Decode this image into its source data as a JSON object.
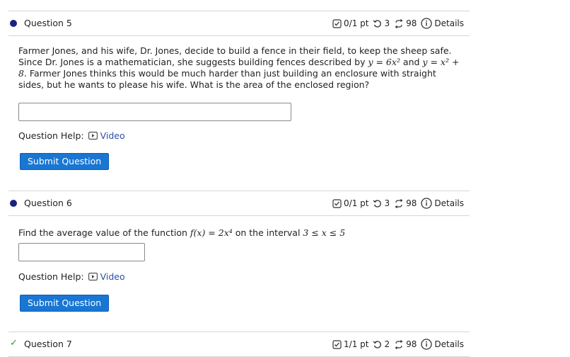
{
  "questions": [
    {
      "title": "Question 5",
      "status": "unanswered",
      "score": "0/1 pt",
      "retries": "3",
      "attempts": "98",
      "details": "Details",
      "text_parts": [
        "Farmer Jones, and his wife, Dr. Jones, decide to build a fence in their field, to keep the sheep safe. Since Dr. Jones is a mathematician, she suggests building fences described by ",
        "y = 6x²",
        " and ",
        "y = x² + 8",
        ". Farmer Jones thinks this would be much harder than just building an enclosure with straight sides, but he wants to please his wife. What is the area of the enclosed region?"
      ],
      "help_label": "Question Help:",
      "video_label": "Video",
      "submit_label": "Submit Question"
    },
    {
      "title": "Question 6",
      "status": "unanswered",
      "score": "0/1 pt",
      "retries": "3",
      "attempts": "98",
      "details": "Details",
      "text_parts": [
        "Find the average value of the function ",
        "f(x) = 2x⁴",
        " on the interval ",
        "3 ≤ x ≤ 5"
      ],
      "help_label": "Question Help:",
      "video_label": "Video",
      "submit_label": "Submit Question"
    },
    {
      "title": "Question 7",
      "status": "correct",
      "score": "1/1 pt",
      "retries": "2",
      "attempts": "98",
      "details": "Details"
    }
  ],
  "colors": {
    "accent": "#1976d2",
    "bullet": "#1a237e",
    "link": "#2d4fa3",
    "correct": "#3a8d3a"
  }
}
